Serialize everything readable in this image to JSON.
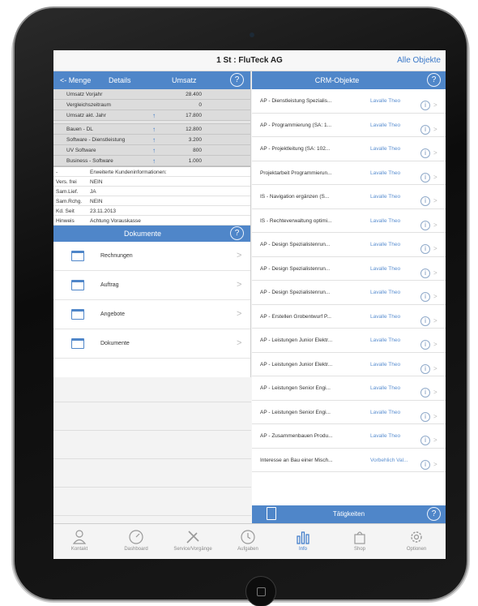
{
  "nav": {
    "title": "1 St : FluTeck AG",
    "all_objects": "Alle Objekte"
  },
  "left_header": {
    "menu": "<- Menge",
    "details": "Details",
    "umsatz": "Umsatz",
    "info_glyph": "?"
  },
  "stats": [
    {
      "label": "Umsatz Vorjahr",
      "arrow": "",
      "value": "28.400"
    },
    {
      "label": "Vergleichszeitraum",
      "arrow": "",
      "value": "0"
    },
    {
      "label": "Umsatz akt. Jahr",
      "arrow": "↑",
      "value": "17.800"
    }
  ],
  "categories": [
    {
      "label": "Bauen - DL",
      "arrow": "↑",
      "value": "12.800"
    },
    {
      "label": "Software - Dienstleistung",
      "arrow": "↑",
      "value": "3.200"
    },
    {
      "label": "UV Software",
      "arrow": "↑",
      "value": "800"
    },
    {
      "label": "Business - Software",
      "arrow": "↑",
      "value": "1.000"
    }
  ],
  "info": [
    {
      "key": "-",
      "value": "Erweiterte Kundeninformationen:"
    },
    {
      "key": "Vers. frei",
      "value": "NEIN"
    },
    {
      "key": "Sam.Lief.",
      "value": "JA"
    },
    {
      "key": "Sam.Rchg.",
      "value": "NEIN"
    },
    {
      "key": "Kd. Seit",
      "value": "23.11.2013"
    },
    {
      "key": "Hinweis",
      "value": "Achtung Vorauskasse"
    }
  ],
  "documents": {
    "header": "Dokumente",
    "items": [
      "Rechnungen",
      "Auftrag",
      "Angebote",
      "Dokumente"
    ]
  },
  "crm": {
    "header": "CRM-Objekte",
    "items": [
      {
        "name": "AP - Dienstleistung Spezialis...",
        "owner": "Lavalle Theo"
      },
      {
        "name": "AP - Programmierung (SA: 1...",
        "owner": "Lavalle Theo"
      },
      {
        "name": "AP - Projektleitung (SA: 102...",
        "owner": "Lavalle Theo"
      },
      {
        "name": "Projektarbeit Programmierun...",
        "owner": "Lavalle Theo"
      },
      {
        "name": "IS - Navigation ergänzen (S...",
        "owner": "Lavalle Theo"
      },
      {
        "name": "IS - Rechteverwaltung optimi...",
        "owner": "Lavalle Theo"
      },
      {
        "name": "AP - Design Spezialistenrun...",
        "owner": "Lavalle Theo"
      },
      {
        "name": "AP - Design Spezialistenrun...",
        "owner": "Lavalle Theo"
      },
      {
        "name": "AP - Design Spezialistenrun...",
        "owner": "Lavalle Theo"
      },
      {
        "name": "AP - Erstellen Grobentwurf P...",
        "owner": "Lavalle Theo"
      },
      {
        "name": "AP - Leistungen Junior Elektr...",
        "owner": "Lavalle Theo"
      },
      {
        "name": "AP - Leistungen Junior Elektr...",
        "owner": "Lavalle Theo"
      },
      {
        "name": "AP - Leistungen Senior Engi...",
        "owner": "Lavalle Theo"
      },
      {
        "name": "AP - Leistungen Senior Engi...",
        "owner": "Lavalle Theo"
      },
      {
        "name": "AP - Zusammenbauen Produ...",
        "owner": "Lavalle Theo"
      },
      {
        "name": "Interesse an Bau einer Misch...",
        "owner": "Vorbehlich Val..."
      }
    ],
    "row_info_glyph": "i",
    "row_chevron": ">"
  },
  "activities": {
    "label": "Tätigkeiten"
  },
  "tabs": [
    "Kontakt",
    "Dashboard",
    "Service/Vorgänge",
    "Aufgaben",
    "Info",
    "Shop",
    "Optionen"
  ],
  "colors": {
    "accent": "#4f86c9",
    "link": "#3a78c8"
  }
}
